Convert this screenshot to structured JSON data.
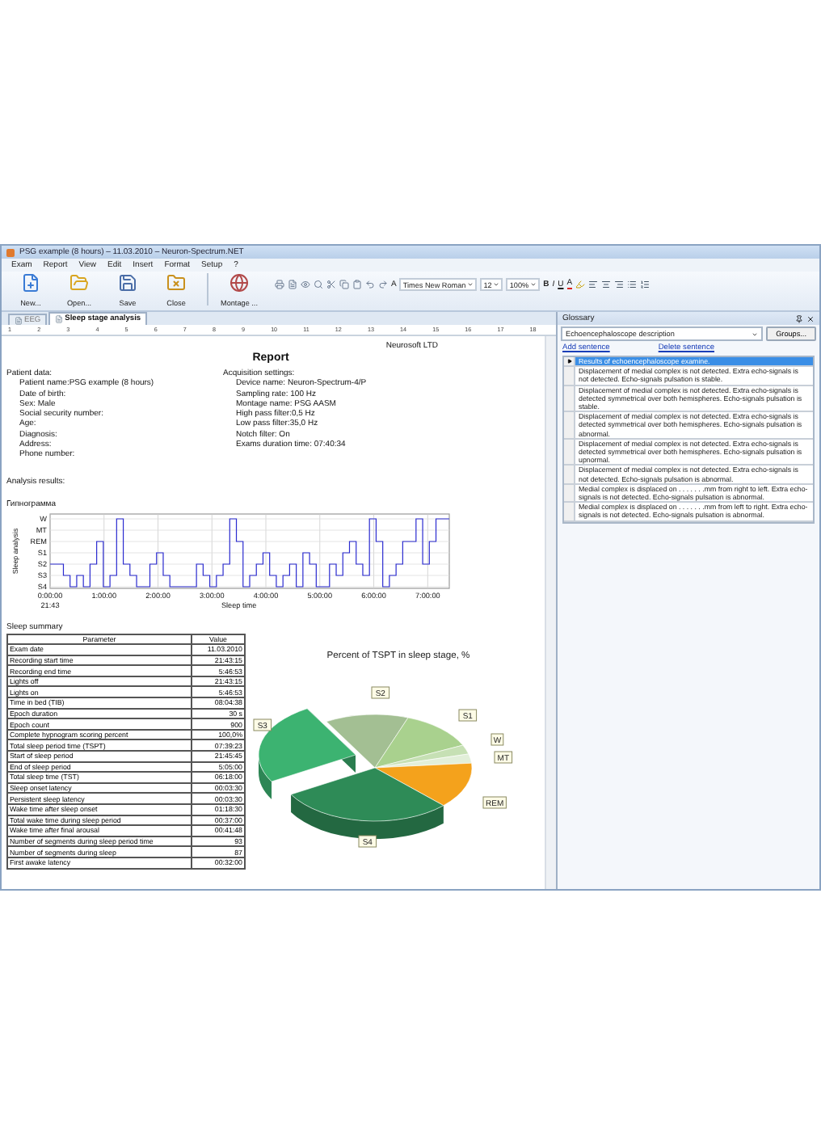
{
  "window": {
    "title": "PSG example (8 hours) – 11.03.2010 – Neuron-Spectrum.NET"
  },
  "menu": [
    "Exam",
    "Report",
    "View",
    "Edit",
    "Insert",
    "Format",
    "Setup",
    "?"
  ],
  "toolbar": {
    "buttons": [
      {
        "label": "New...",
        "kind": "new"
      },
      {
        "label": "Open...",
        "kind": "open"
      },
      {
        "label": "Save",
        "kind": "save"
      },
      {
        "label": "Close",
        "kind": "close"
      },
      {
        "label": "Montage ...",
        "kind": "montage"
      }
    ],
    "font_letter": "A",
    "font_name": "Times New Roman",
    "font_size": "12",
    "zoom": "100%",
    "format_buttons": [
      "B",
      "I",
      "U"
    ],
    "color_letter": "A"
  },
  "tabs": [
    {
      "label": "EEG",
      "selected": false
    },
    {
      "label": "Sleep stage analysis",
      "selected": true
    }
  ],
  "ruler": [
    "1",
    "2",
    "3",
    "4",
    "5",
    "6",
    "7",
    "8",
    "9",
    "10",
    "11",
    "12",
    "13",
    "14",
    "15",
    "16",
    "17",
    "18"
  ],
  "report": {
    "company": "Neurosoft LTD",
    "title": "Report",
    "patient": {
      "heading": "Patient data:",
      "lines": [
        "Patient name:PSG example (8 hours)",
        "Date of birth:",
        "Sex: Male",
        "Social security number:",
        "Age:",
        "Diagnosis:",
        "Address:",
        "Phone number:"
      ]
    },
    "acquisition": {
      "heading": "Acquisition settings:",
      "lines": [
        "Device name: Neuron-Spectrum-4/P",
        "Sampling rate: 100 Hz",
        "Montage name: PSG AASM",
        "High pass filter:0,5 Hz",
        "Low pass filter:35,0 Hz",
        "Notch filter: On",
        "Exams duration time: 07:40:34"
      ]
    },
    "analysis_heading": "Analysis results:",
    "hypnogram": {
      "title": "Гипнограмма",
      "ylabel": "Sleep analysis",
      "xlabel": "Sleep time",
      "stages": [
        "W",
        "MT",
        "REM",
        "S1",
        "S2",
        "S3",
        "S4"
      ],
      "x_ticks": [
        "0:00:00",
        "1:00:00",
        "2:00:00",
        "3:00:00",
        "4:00:00",
        "5:00:00",
        "6:00:00",
        "7:00:00"
      ],
      "start_time": "21:43"
    },
    "summary": {
      "title": "Sleep summary",
      "columns": [
        "Parameter",
        "Value"
      ],
      "rows": [
        [
          "Exam date",
          "11.03.2010"
        ],
        [
          "Recording start time",
          "21:43:15"
        ],
        [
          "Recording end time",
          "5:46:53"
        ],
        [
          "Lights off",
          "21:43:15"
        ],
        [
          "Lights on",
          "5:46:53"
        ],
        [
          "Time in bed (TIB)",
          "08:04:38"
        ],
        [
          "Epoch duration",
          "30 s"
        ],
        [
          "Epoch count",
          "900"
        ],
        [
          "Complete hypnogram scoring percent",
          "100,0%"
        ],
        [
          "Total sleep period time (TSPT)",
          "07:39:23"
        ],
        [
          "Start of sleep period",
          "21:45:45"
        ],
        [
          "End of sleep period",
          "5:05:00"
        ],
        [
          "Total sleep time (TST)",
          "06:18:00"
        ],
        [
          "Sleep onset latency",
          "00:03:30"
        ],
        [
          "Persistent sleep latency",
          "00:03:30"
        ],
        [
          "Wake time after sleep onset",
          "01:18:30"
        ],
        [
          "Total wake time during sleep period",
          "00:37:00"
        ],
        [
          "Wake time after final arousal",
          "00:41:48"
        ],
        [
          "Number of segments during sleep period time",
          "93"
        ],
        [
          "Number of segments during sleep",
          "87"
        ],
        [
          "First awake latency",
          "00:32:00"
        ]
      ]
    },
    "pie": {
      "title": "Percent of TSPT in sleep stage, %",
      "slices": [
        {
          "label": "S2",
          "color": "#a3bf93"
        },
        {
          "label": "S1",
          "color": "#a9d18e"
        },
        {
          "label": "W",
          "color": "#c6e0b4"
        },
        {
          "label": "MT",
          "color": "#e2efd9"
        },
        {
          "label": "REM",
          "color": "#f4a21c"
        },
        {
          "label": "S4",
          "color": "#2e8b57"
        },
        {
          "label": "S3",
          "color": "#3cb371"
        }
      ]
    }
  },
  "glossary": {
    "title": "Glossary",
    "section": "Echoencephaloscope description",
    "groups_button": "Groups...",
    "links": [
      "Add sentence",
      "Delete sentence"
    ],
    "sentences": [
      {
        "text": "Results of echoencephaloscope examine.",
        "selected": true
      },
      {
        "text": "Displacement of medial complex is not detected. Extra echo-signals is not detected. Echo-signals pulsation is stable.",
        "selected": false
      },
      {
        "text": "Displacement of medial complex is not detected. Extra echo-signals is detected symmetrical over both hemispheres. Echo-signals pulsation is stable.",
        "selected": false
      },
      {
        "text": "Displacement of medial complex is not detected. Extra echo-signals is detected symmetrical over both hemispheres. Echo-signals pulsation is abnormal.",
        "selected": false
      },
      {
        "text": "Displacement of medial complex is not detected. Extra echo-signals is detected symmetrical over both hemispheres. Echo-signals pulsation is upnormal.",
        "selected": false
      },
      {
        "text": "Displacement of medial complex is not detected. Extra echo-signals is not detected. Echo-signals pulsation is abnormal.",
        "selected": false
      },
      {
        "text": "Medial complex is displaced on . . . . . . .mm from right to left. Extra echo-signals is not detected. Echo-signals pulsation is abnormal.",
        "selected": false
      },
      {
        "text": "Medial complex is displaced on . . . . . . .mm from left to right. Extra echo-signals is not detected. Echo-signals pulsation is abnormal.",
        "selected": false
      }
    ]
  }
}
